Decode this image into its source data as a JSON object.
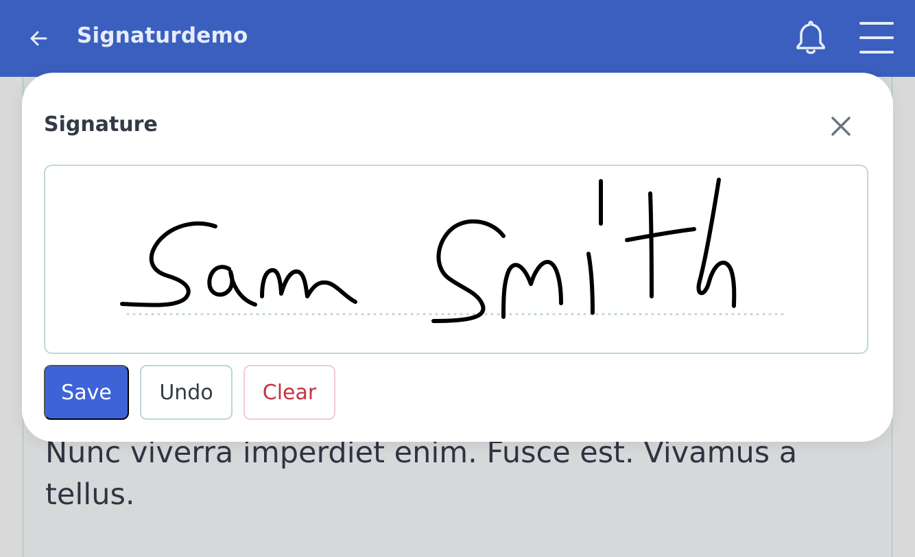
{
  "appbar": {
    "title": "Signaturdemo",
    "back_icon": "arrow-left-icon",
    "bell_icon": "bell-icon",
    "menu_icon": "hamburger-menu-icon",
    "color": "#3b5fbe"
  },
  "page": {
    "body_text": "Nunc viverra imperdiet enim. Fusce est. Vivamus a tellus."
  },
  "modal": {
    "title": "Signature",
    "close_icon": "close-icon",
    "signature": "Sam Smith",
    "buttons": {
      "save": "Save",
      "undo": "Undo",
      "clear": "Clear"
    },
    "colors": {
      "save_bg": "#3d63d6",
      "clear_text": "#c4323f"
    }
  }
}
